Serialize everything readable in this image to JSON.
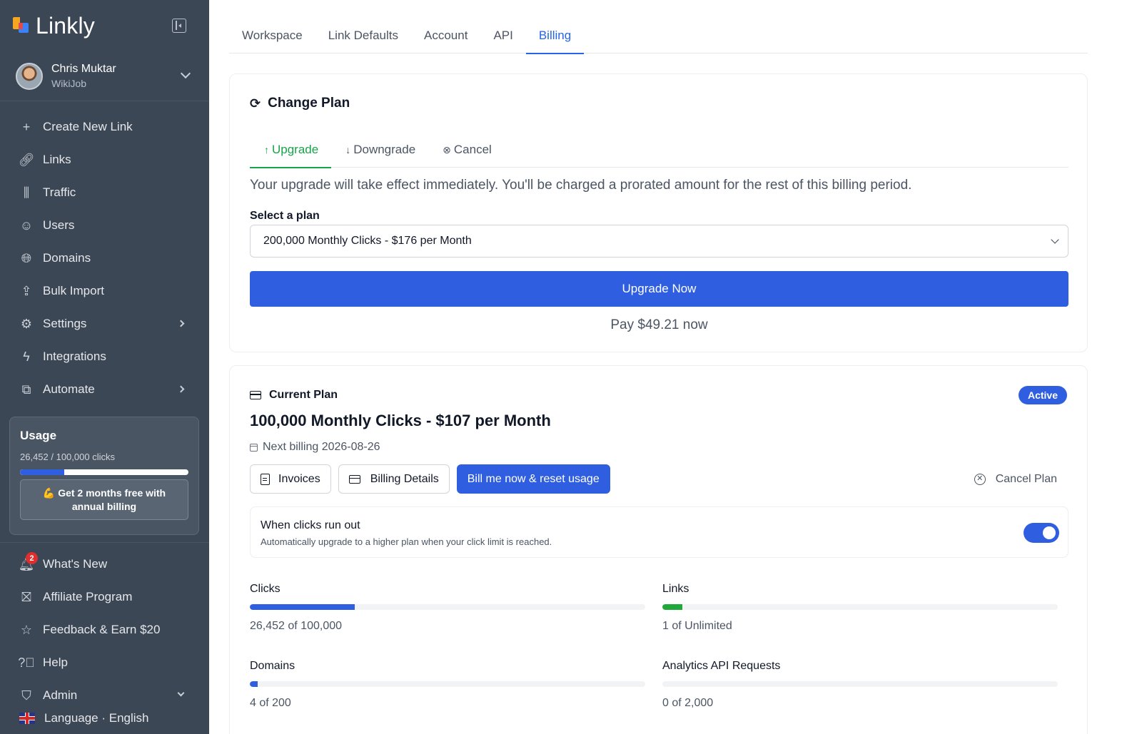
{
  "app": {
    "name": "Linkly"
  },
  "user": {
    "name": "Chris Muktar",
    "org": "WikiJob"
  },
  "nav": [
    {
      "id": "create",
      "label": "Create New Link",
      "icon": "plus-icon",
      "glyph": "+",
      "chevron": false
    },
    {
      "id": "links",
      "label": "Links",
      "icon": "link-icon",
      "glyph": "🔗︎",
      "chevron": false
    },
    {
      "id": "traffic",
      "label": "Traffic",
      "icon": "bar-chart-icon",
      "glyph": "⫼",
      "chevron": false
    },
    {
      "id": "users",
      "label": "Users",
      "icon": "users-icon",
      "glyph": "☺",
      "chevron": false
    },
    {
      "id": "domains",
      "label": "Domains",
      "icon": "globe-icon",
      "glyph": "🌐︎",
      "chevron": false
    },
    {
      "id": "bulk",
      "label": "Bulk Import",
      "icon": "upload-icon",
      "glyph": "⇪",
      "chevron": false
    },
    {
      "id": "settings",
      "label": "Settings",
      "icon": "gear-icon",
      "glyph": "⚙",
      "chevron": true
    },
    {
      "id": "integrations",
      "label": "Integrations",
      "icon": "lightning-icon",
      "glyph": "ϟ",
      "chevron": false
    },
    {
      "id": "automate",
      "label": "Automate",
      "icon": "workflow-icon",
      "glyph": "⧉",
      "chevron": true
    }
  ],
  "usage": {
    "title": "Usage",
    "summary": "26,452 / 100,000 clicks",
    "fraction": 0.2645,
    "promo": "💪 Get 2 months free with annual billing"
  },
  "nav2": [
    {
      "id": "whats-new",
      "label": "What's New",
      "icon": "bell-icon",
      "glyph": "🔔︎",
      "badge": "2"
    },
    {
      "id": "affiliate",
      "label": "Affiliate Program",
      "icon": "gift-icon",
      "glyph": "⛝",
      "badge": ""
    },
    {
      "id": "feedback",
      "label": "Feedback & Earn $20",
      "icon": "star-icon",
      "glyph": "☆",
      "badge": ""
    },
    {
      "id": "help",
      "label": "Help",
      "icon": "help-circle-icon",
      "glyph": "?⃝",
      "badge": ""
    },
    {
      "id": "admin",
      "label": "Admin",
      "icon": "shield-icon",
      "glyph": "⛉",
      "badge": ""
    }
  ],
  "language": {
    "label": "Language · English"
  },
  "tabs": [
    {
      "label": "Workspace",
      "active": false
    },
    {
      "label": "Link Defaults",
      "active": false
    },
    {
      "label": "Account",
      "active": false
    },
    {
      "label": "API",
      "active": false
    },
    {
      "label": "Billing",
      "active": true
    }
  ],
  "change_plan": {
    "title": "Change Plan",
    "tabs": [
      {
        "label": "Upgrade",
        "glyph": "↑",
        "icon": "arrow-up-icon",
        "active": true
      },
      {
        "label": "Downgrade",
        "glyph": "↓",
        "icon": "arrow-down-icon",
        "active": false
      },
      {
        "label": "Cancel",
        "glyph": "⊗",
        "icon": "x-circle-icon",
        "active": false
      }
    ],
    "description": "Your upgrade will take effect immediately. You'll be charged a prorated amount for the rest of this billing period.",
    "select_label": "Select a plan",
    "selected_plan": "200,000 Monthly Clicks - $176 per Month",
    "button": "Upgrade Now",
    "pay_note": "Pay $49.21 now"
  },
  "current_plan": {
    "header": "Current Plan",
    "badge": "Active",
    "title": "100,000 Monthly Clicks - $107 per Month",
    "next_billing": "Next billing 2026-08-26",
    "buttons": {
      "invoices": "Invoices",
      "billing_details": "Billing Details",
      "bill_now": "Bill me now & reset usage"
    },
    "cancel": "Cancel Plan",
    "auto_upgrade": {
      "title": "When clicks run out",
      "subtitle": "Automatically upgrade to a higher plan when your click limit is reached.",
      "enabled": true
    },
    "metrics": [
      {
        "label": "Clicks",
        "value": "26,452 of 100,000",
        "fraction": 0.2645,
        "color": "#2f5fe0"
      },
      {
        "label": "Links",
        "value": "1 of Unlimited",
        "fraction": 0.05,
        "color": "#22a83a"
      },
      {
        "label": "Domains",
        "value": "4 of 200",
        "fraction": 0.02,
        "color": "#2f5fe0"
      },
      {
        "label": "Analytics API Requests",
        "value": "0 of 2,000",
        "fraction": 0,
        "color": "#2f5fe0"
      }
    ]
  }
}
